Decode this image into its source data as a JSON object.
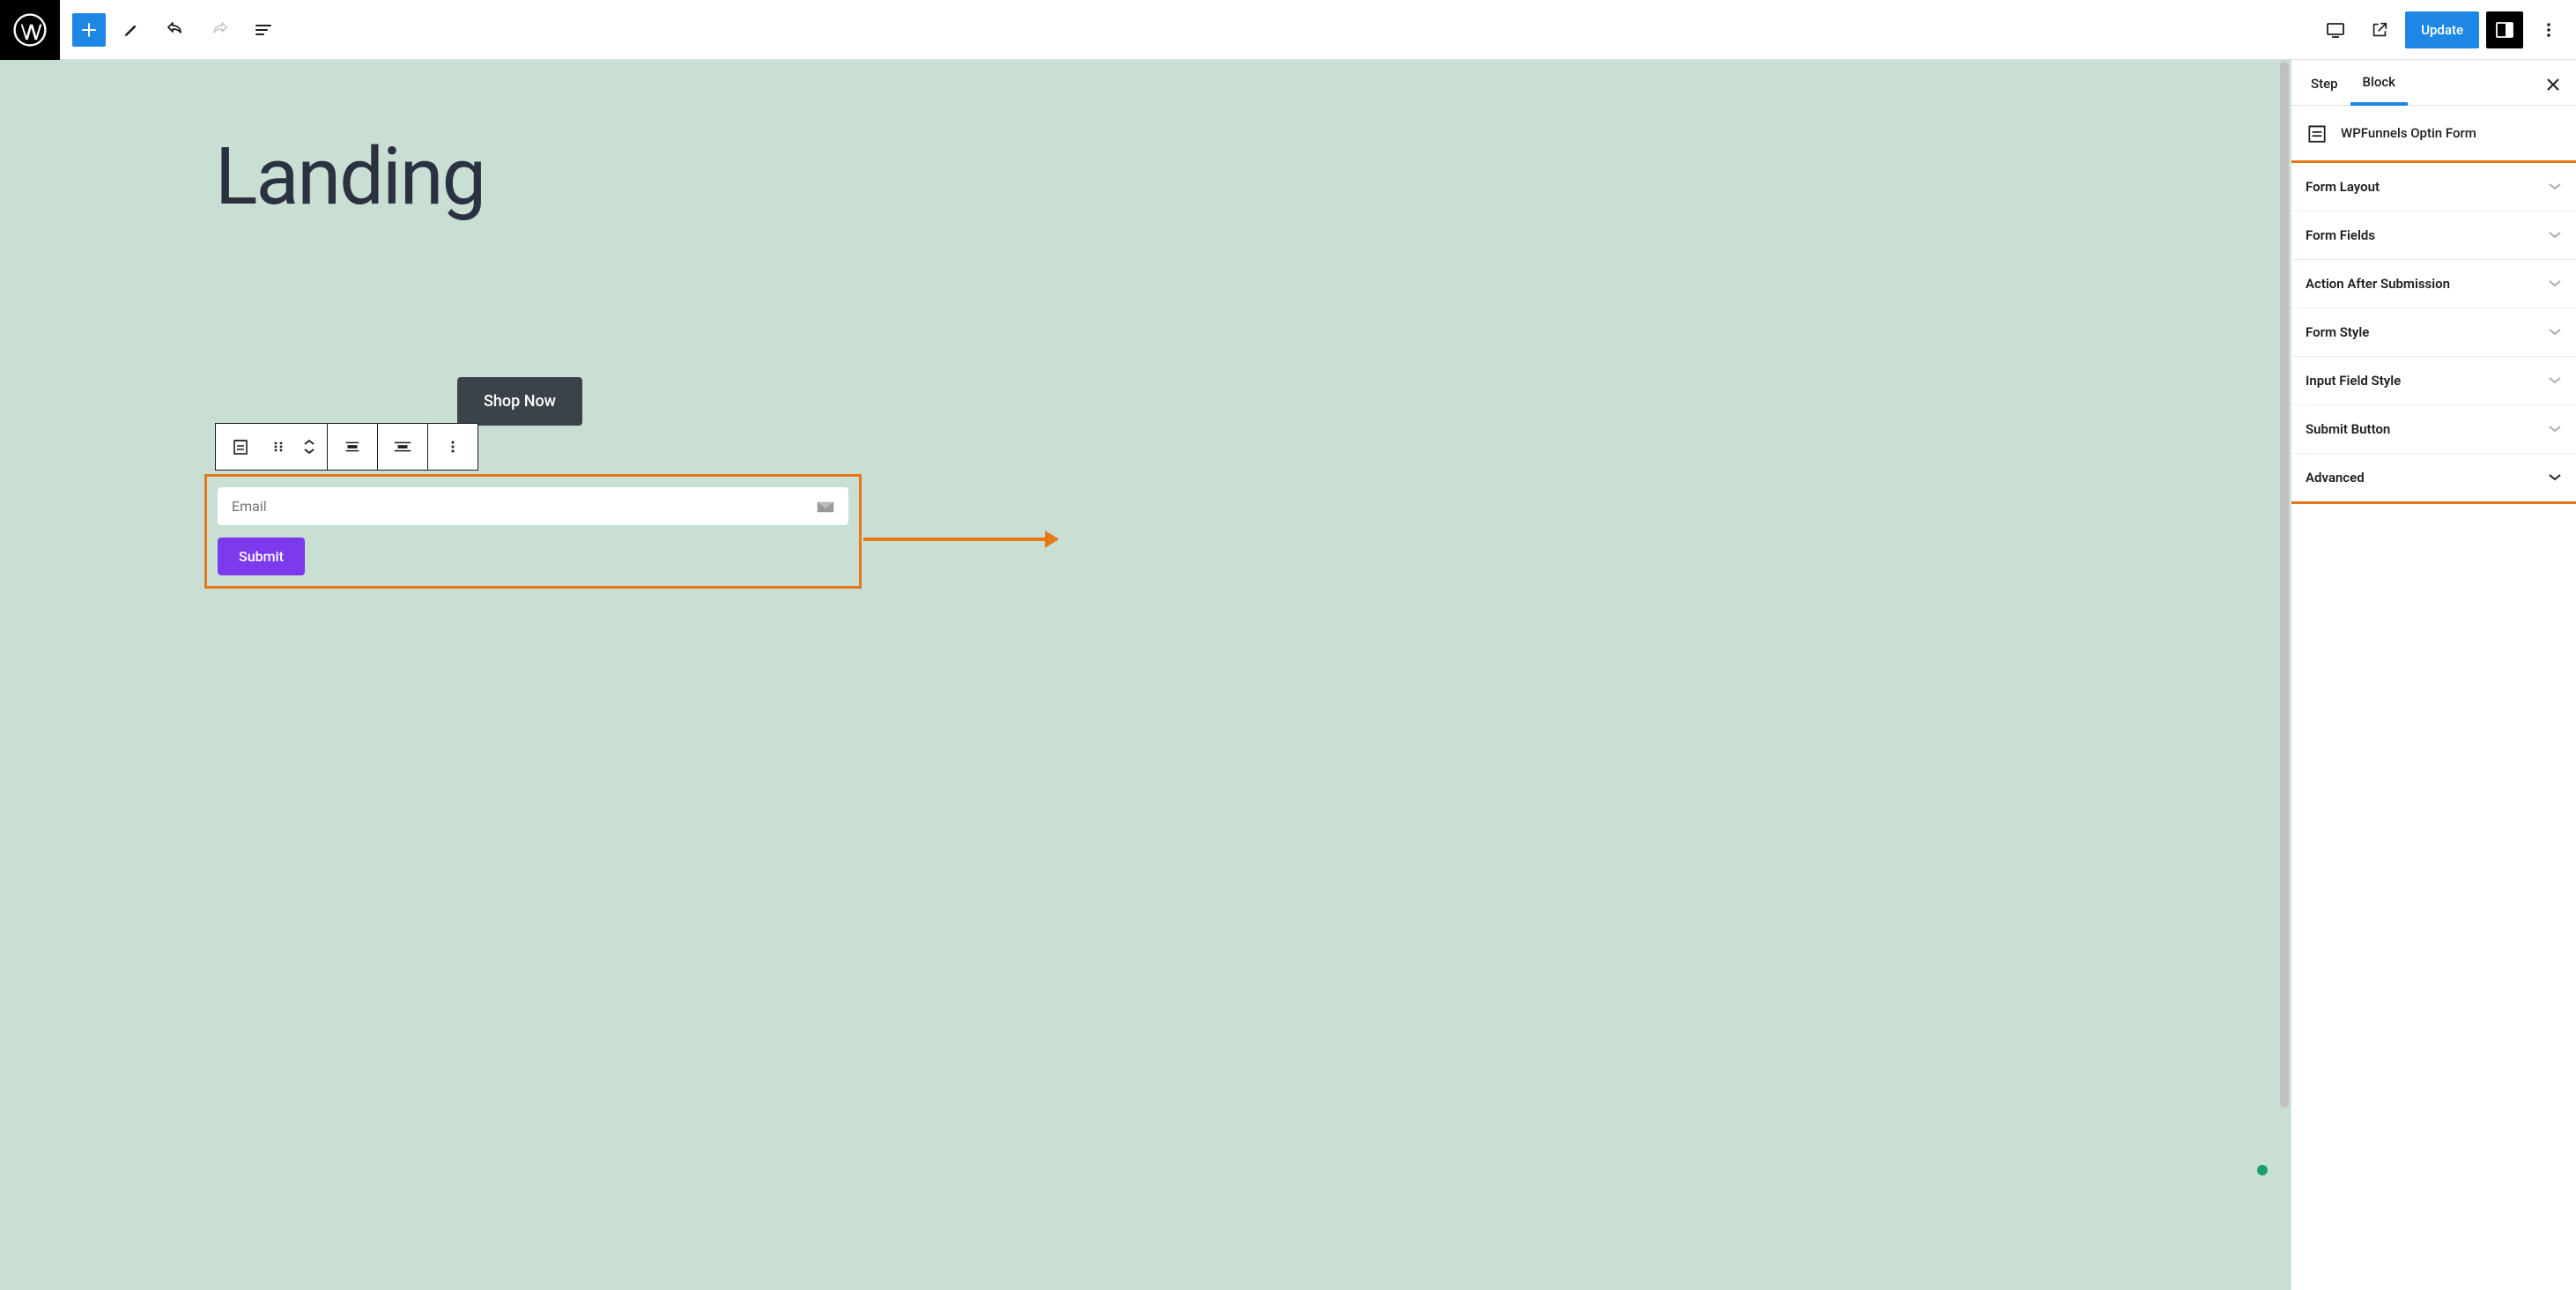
{
  "topbar": {
    "update_label": "Update"
  },
  "canvas": {
    "page_title": "Landing",
    "shop_now_label": "Shop Now",
    "email_placeholder": "Email",
    "submit_label": "Submit"
  },
  "sidebar": {
    "tabs": {
      "step": "Step",
      "block": "Block"
    },
    "block_name": "WPFunnels Optin Form",
    "panels": [
      {
        "title": "Form Layout"
      },
      {
        "title": "Form Fields"
      },
      {
        "title": "Action After Submission"
      },
      {
        "title": "Form Style"
      },
      {
        "title": "Input Field Style"
      },
      {
        "title": "Submit Button"
      },
      {
        "title": "Advanced"
      }
    ]
  },
  "colors": {
    "accent": "#1e87e5",
    "highlight": "#e67817",
    "submit": "#7c3aed",
    "canvas_bg": "#cadfd4"
  }
}
